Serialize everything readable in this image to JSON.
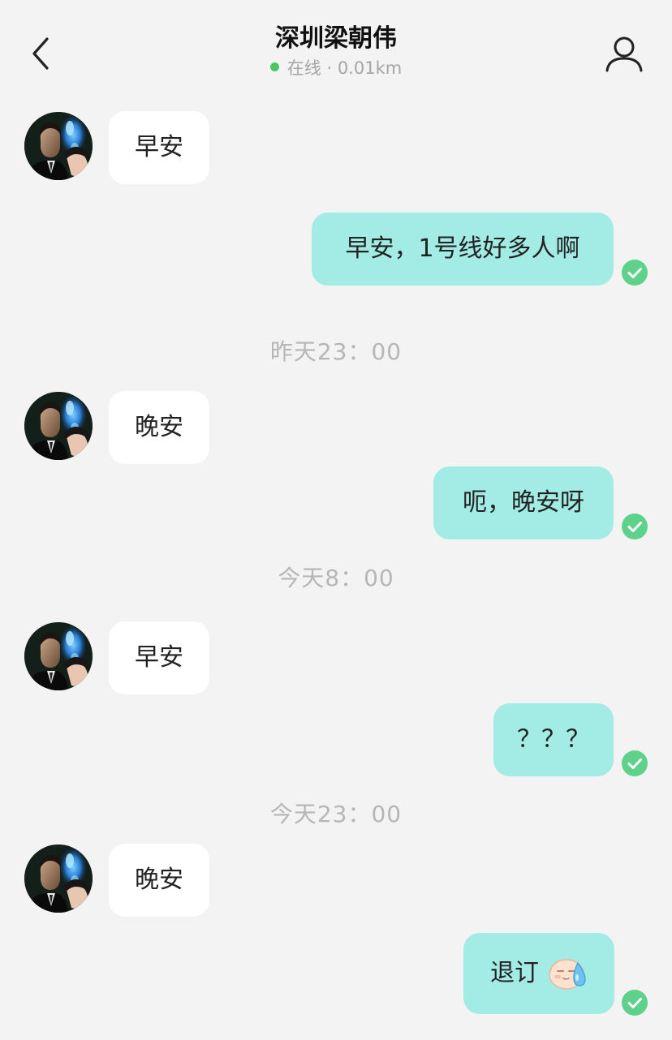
{
  "header": {
    "title": "深圳梁朝伟",
    "status": "在线 · 0.01km",
    "status_color": "#4cc764"
  },
  "icons": {
    "back": "chevron-left-icon",
    "profile": "person-icon",
    "read": "check-circle-icon",
    "emoji": "sweat-face-emoji"
  },
  "colors": {
    "background": "#f3f3f3",
    "incoming_bubble": "#ffffff",
    "outgoing_bubble": "#a3ece5",
    "read_check": "#5ed28a"
  },
  "messages": [
    {
      "side": "in",
      "text": "早安"
    },
    {
      "side": "out",
      "text": "早安，1号线好多人啊"
    },
    {
      "timestamp": "昨天23：00"
    },
    {
      "side": "in",
      "text": "晚安"
    },
    {
      "side": "out",
      "text": "呃，晚安呀"
    },
    {
      "timestamp": "今天8：00"
    },
    {
      "side": "in",
      "text": "早安"
    },
    {
      "side": "out",
      "text": "？？？"
    },
    {
      "timestamp": "今天23：00"
    },
    {
      "side": "in",
      "text": "晚安"
    },
    {
      "side": "out",
      "text": "退订",
      "emoji": "sweat-face-emoji"
    }
  ]
}
